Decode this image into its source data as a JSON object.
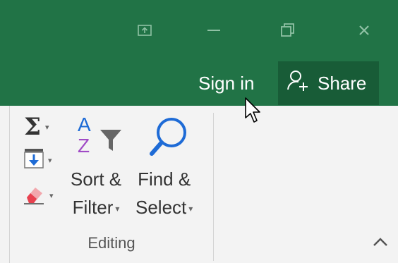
{
  "titlebar": {
    "background": "#217346",
    "buttons": {
      "ribbon_display_icon": "ribbon-display-options-icon",
      "minimize_icon": "minimize-icon",
      "restore_icon": "restore-icon",
      "close_icon": "close-icon"
    },
    "signin_label": "Sign in",
    "share_label": "Share",
    "share_background": "#185c37"
  },
  "ribbon": {
    "group_label": "Editing",
    "autosum_icon": "sigma-icon",
    "fill_icon": "fill-down-icon",
    "clear_icon": "eraser-icon",
    "sort_filter": {
      "icon": "sort-az-filter-icon",
      "label_line1": "Sort &",
      "label_line2": "Filter",
      "sort_letter_a": "A",
      "sort_letter_z": "Z"
    },
    "find_select": {
      "icon": "magnifier-icon",
      "label_line1": "Find &",
      "label_line2": "Select"
    },
    "collapse_icon": "chevron-up-icon"
  },
  "cursor_icon": "mouse-pointer-icon"
}
